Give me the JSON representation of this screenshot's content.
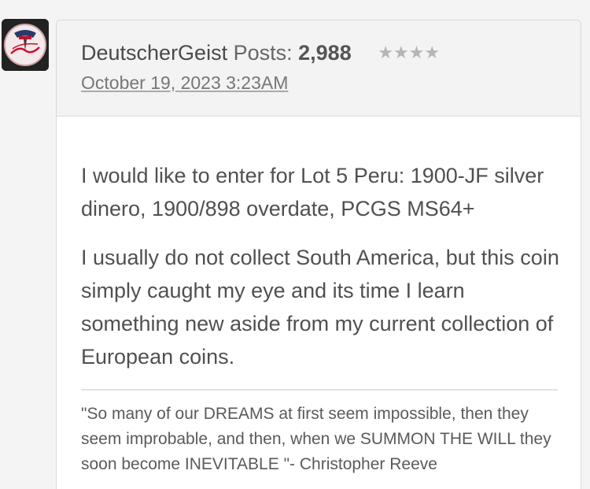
{
  "post": {
    "author": "DeutscherGeist",
    "posts_label": "Posts:",
    "posts_count": "2,988",
    "rank_stars": "★★★★",
    "date": "October 19, 2023 3:23AM",
    "body": [
      "I would like to enter for Lot 5 Peru: 1900-JF silver dinero, 1900/898 overdate, PCGS MS64+",
      "I usually do not collect South America, but this coin simply caught my eye and its time I learn something new aside from my current collection of European coins."
    ],
    "signature": "\"So many of our DREAMS at first seem impossible, then they seem improbable, and then, when we SUMMON THE WILL they soon become INEVITABLE \"- Christopher Reeve"
  },
  "avatar": {
    "icon": "yankees-logo-icon",
    "colors": {
      "bg": "#222222",
      "badge": "#f2e6e6",
      "accent": "#c8102e"
    }
  }
}
